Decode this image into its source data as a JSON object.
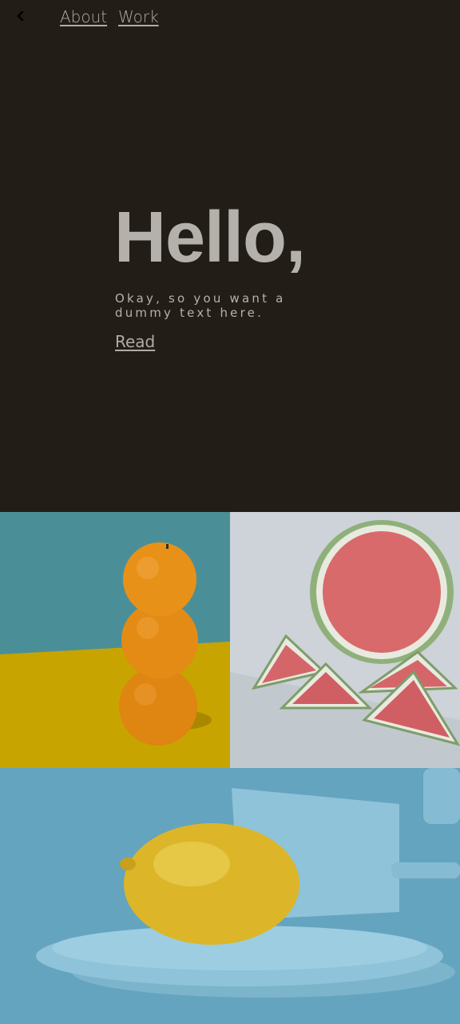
{
  "nav": {
    "back_icon": "chevron-left-icon",
    "links": [
      {
        "label": "About"
      },
      {
        "label": "Work"
      }
    ]
  },
  "hero": {
    "headline": "Hello,",
    "subtitle": "Okay, so you want a dummy text here.",
    "read_link": "Read"
  },
  "gallery": {
    "images": [
      "oranges-stack-image",
      "watermelon-image",
      "lemon-plate-image"
    ]
  },
  "colors": {
    "background": "#221e17",
    "text": "#b4b1ad"
  }
}
